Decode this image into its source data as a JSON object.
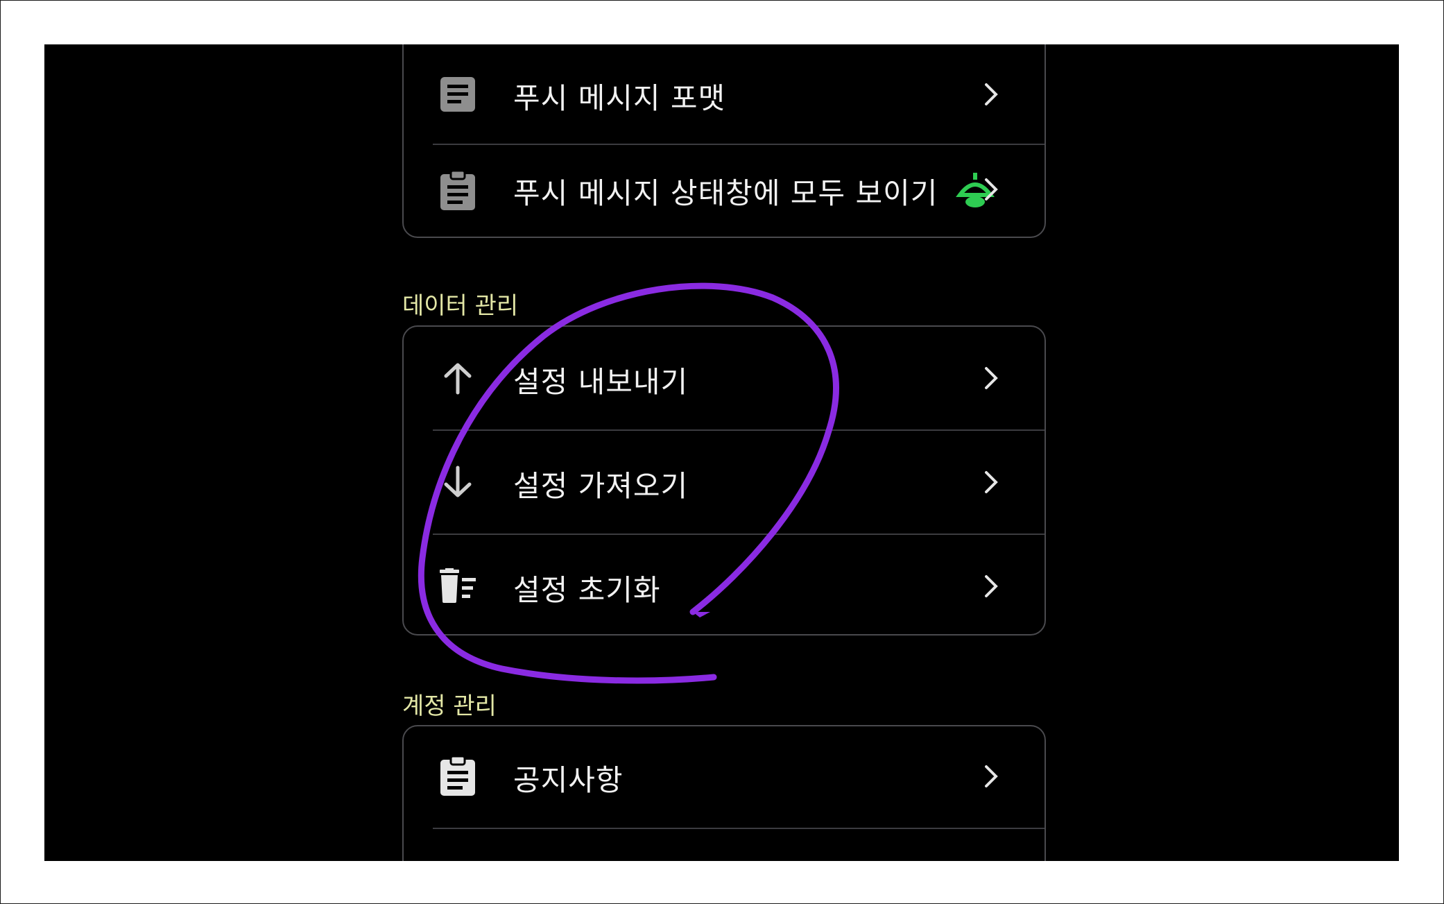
{
  "push_section": {
    "items": [
      {
        "label": "푸시 메시지 포맷",
        "icon": "document-icon"
      },
      {
        "label": "푸시 메시지 상태창에 모두 보이기",
        "icon": "clipboard-icon",
        "extra_icon": "green-bell-icon"
      }
    ]
  },
  "data_section": {
    "title": "데이터 관리",
    "items": [
      {
        "label": "설정 내보내기",
        "icon": "arrow-up-icon"
      },
      {
        "label": "설정 가져오기",
        "icon": "arrow-down-icon"
      },
      {
        "label": "설정 초기화",
        "icon": "trash-list-icon"
      }
    ]
  },
  "account_section": {
    "title": "계정 관리",
    "items": [
      {
        "label": "공지사항",
        "icon": "clipboard-icon"
      }
    ]
  },
  "colors": {
    "background": "#000000",
    "card_border": "#4a4a4e",
    "section_title": "#e3e7a6",
    "annotation": "#8a2be2",
    "bell": "#2ecc52"
  }
}
